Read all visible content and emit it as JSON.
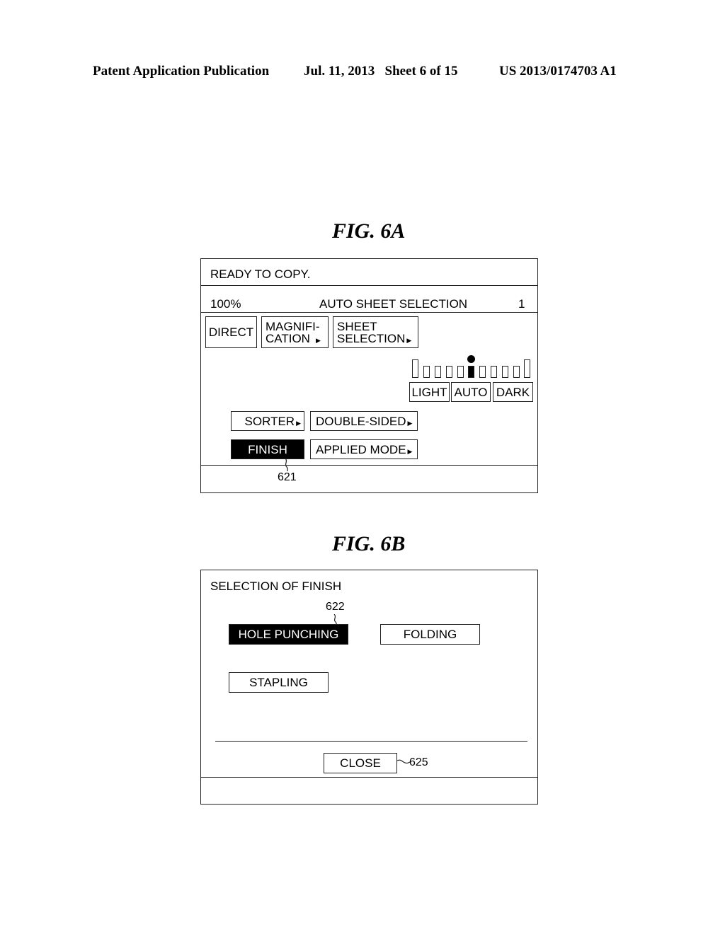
{
  "header": {
    "publication": "Patent Application Publication",
    "date_sheet": "Jul. 11, 2013   Sheet 6 of 15",
    "number": "US 2013/0174703 A1"
  },
  "fig6a": {
    "label": "FIG. 6A",
    "status": "READY TO COPY.",
    "magnification": "100%",
    "sheet_mode": "AUTO SHEET SELECTION",
    "copies": "1",
    "buttons": {
      "direct": "DIRECT",
      "magnification_l1": "MAGNIFI-",
      "magnification_l2": "CATION",
      "sheet_l1": "SHEET",
      "sheet_l2": "SELECTION",
      "sorter": "SORTER",
      "double_sided": "DOUBLE-SIDED",
      "finish": "FINISH",
      "applied_mode": "APPLIED MODE"
    },
    "density": {
      "segments": 11,
      "selected_index": 5,
      "light": "LIGHT",
      "auto": "AUTO",
      "dark": "DARK"
    },
    "ref_finish": "621",
    "arrow_glyph": "▶"
  },
  "fig6b": {
    "label": "FIG. 6B",
    "title": "SELECTION OF FINISH",
    "buttons": {
      "hole_punching": "HOLE PUNCHING",
      "folding": "FOLDING",
      "stapling": "STAPLING",
      "close": "CLOSE"
    },
    "ref_hole_punching": "622",
    "ref_close": "625",
    "selected": "HOLE PUNCHING"
  }
}
